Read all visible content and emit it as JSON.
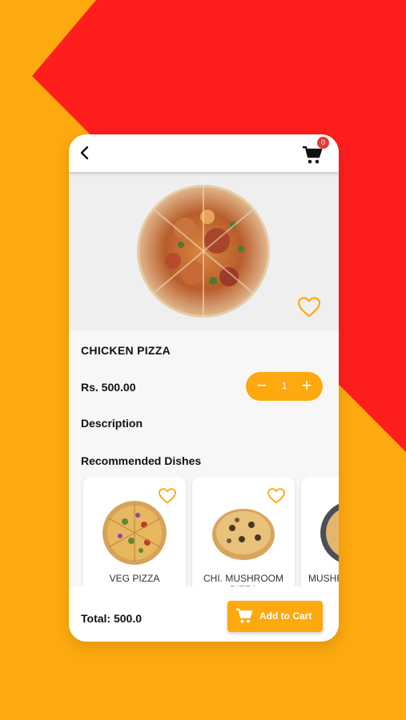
{
  "colors": {
    "accent": "#FDA90F",
    "background_red": "#FF1E1E",
    "background_orange": "#FDA90F",
    "badge": "#E53935"
  },
  "topbar": {
    "back_icon": "chevron-left-icon",
    "cart_icon": "cart-icon",
    "cart_count": "0"
  },
  "product": {
    "name": "CHICKEN PIZZA",
    "price": "Rs. 500.00",
    "quantity": "1",
    "image": "chicken-pizza-photo",
    "favorite_icon": "heart-outline-icon"
  },
  "quantity_control": {
    "minus": "−",
    "plus": "+"
  },
  "sections": {
    "description": "Description",
    "recommended": "Recommended Dishes"
  },
  "recommended": [
    {
      "name": "VEG PIZZA",
      "favorite_icon": "heart-outline-icon"
    },
    {
      "name": "CHI. MUSHROOM PIZZA",
      "favorite_icon": "heart-outline-icon"
    },
    {
      "name": "MUSHROOM PIZZA",
      "favorite_icon": "heart-outline-icon"
    }
  ],
  "footer": {
    "total": "Total: 500.0",
    "add_to_cart": "Add to Cart",
    "cart_icon": "cart-icon"
  }
}
